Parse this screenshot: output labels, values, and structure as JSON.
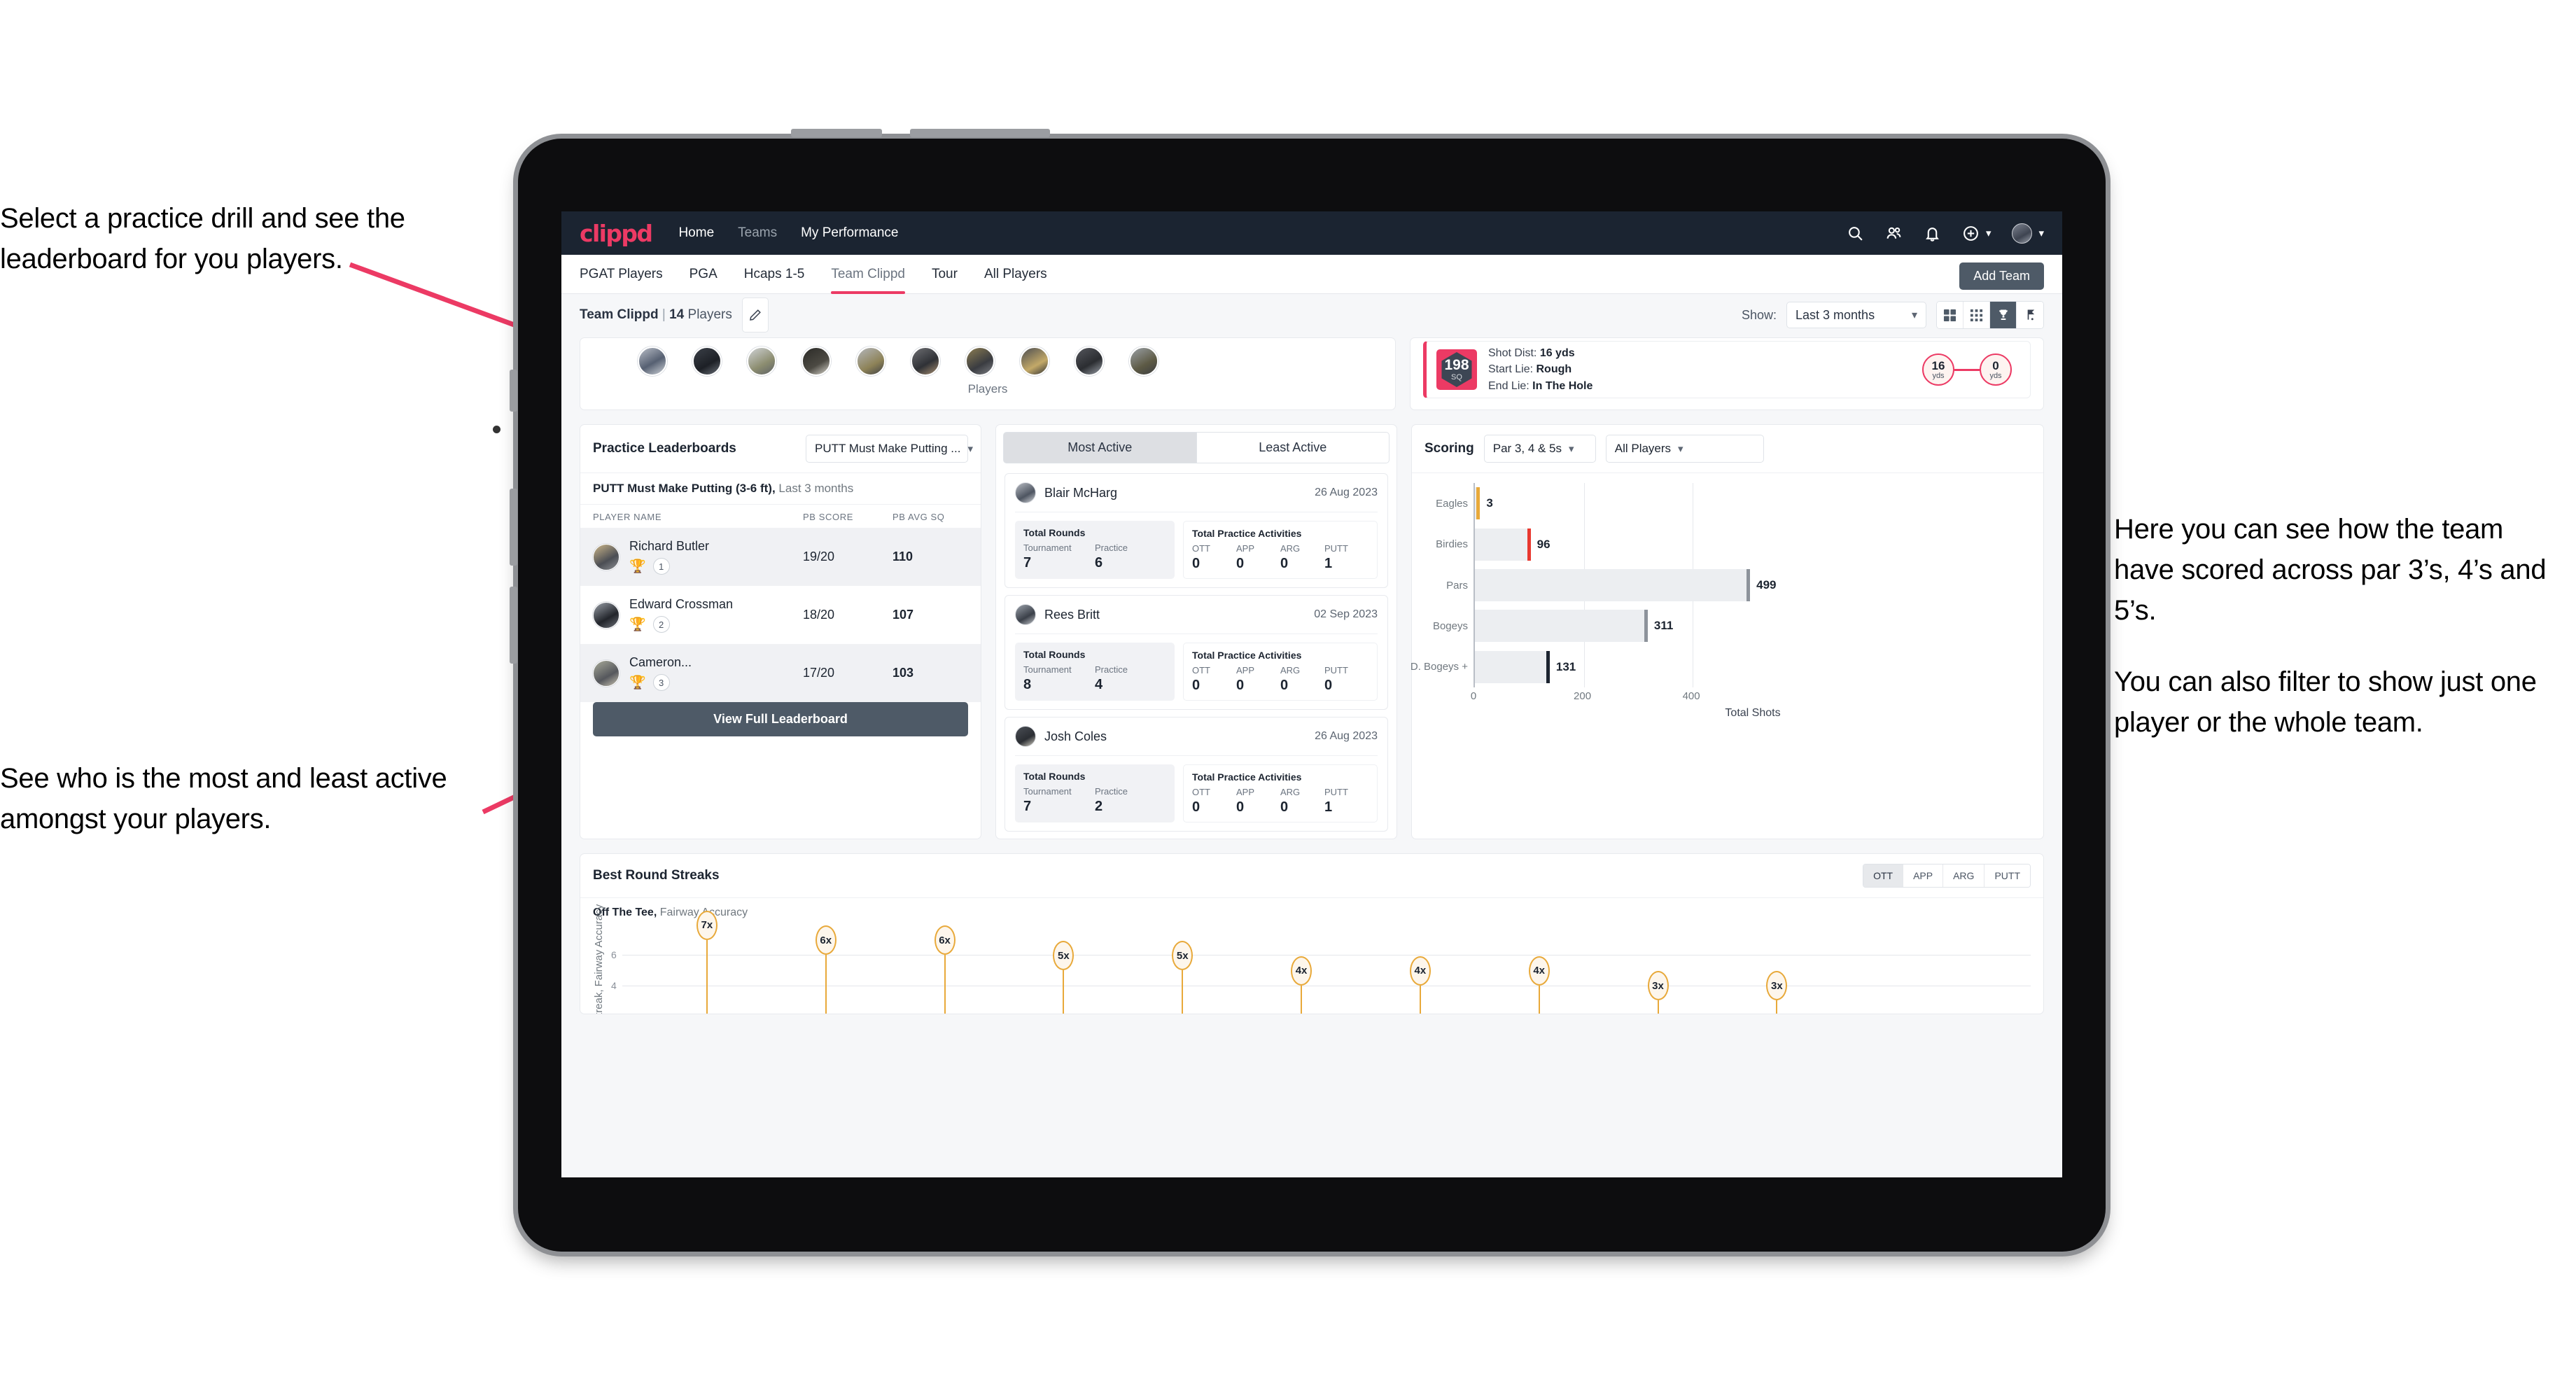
{
  "annotations": {
    "top_left": [
      "Select a practice drill and see the leaderboard for you players."
    ],
    "bottom_left": [
      "See who is the most and least active amongst your players."
    ],
    "right": [
      "Here you can see how the team have scored across par 3’s, 4’s and 5’s.",
      "You can also filter to show just one player or the whole team."
    ]
  },
  "appbar": {
    "logo": "clippd",
    "nav": [
      {
        "label": "Home",
        "active": true
      },
      {
        "label": "Teams",
        "active": false
      },
      {
        "label": "My Performance",
        "active": true
      }
    ],
    "icons": [
      "search-icon",
      "people-icon",
      "bell-icon",
      "plus-circle-icon",
      "avatar"
    ]
  },
  "tabs": [
    {
      "label": "PGAT Players",
      "active": false
    },
    {
      "label": "PGA",
      "active": false
    },
    {
      "label": "Hcaps 1-5",
      "active": false
    },
    {
      "label": "Team Clippd",
      "active": true
    },
    {
      "label": "Tour",
      "active": false
    },
    {
      "label": "All Players",
      "active": false
    }
  ],
  "add_team_button": "Add Team",
  "team_header": {
    "team": "Team Clippd",
    "separator": "|",
    "count": "14",
    "players_word": "Players",
    "edit_icon": "pencil-icon"
  },
  "show_filter": {
    "label": "Show:",
    "value": "Last 3 months"
  },
  "view_toggle": [
    {
      "icon": "grid-large-icon",
      "active": false
    },
    {
      "icon": "grid-small-icon",
      "active": false
    },
    {
      "icon": "trophy-icon",
      "active": true
    },
    {
      "icon": "golf-flag-icon",
      "active": false
    }
  ],
  "players_strip": {
    "label": "Players",
    "avatar_count": 10
  },
  "shot_card": {
    "sq_value": "198",
    "sq_unit": "SQ",
    "lines": [
      {
        "label": "Shot Dist:",
        "value": "16 yds"
      },
      {
        "label": "Start Lie:",
        "value": "Rough"
      },
      {
        "label": "End Lie:",
        "value": "In The Hole"
      }
    ],
    "start_dist": {
      "value": "16",
      "unit": "yds"
    },
    "end_dist": {
      "value": "0",
      "unit": "yds"
    }
  },
  "leaderboard": {
    "title": "Practice Leaderboards",
    "drill_select": "PUTT Must Make Putting ...",
    "subtitle_bold": "PUTT Must Make Putting (3-6 ft),",
    "subtitle_light": "Last 3 months",
    "columns": [
      "PLAYER NAME",
      "PB SCORE",
      "PB AVG SQ"
    ],
    "rows": [
      {
        "name": "Richard Butler",
        "rank": "1",
        "medal": "gold",
        "score": "19/20",
        "avg": "110"
      },
      {
        "name": "Edward Crossman",
        "rank": "2",
        "medal": "silver",
        "score": "18/20",
        "avg": "107"
      },
      {
        "name": "Cameron...",
        "rank": "3",
        "medal": "bronze",
        "score": "17/20",
        "avg": "103"
      }
    ],
    "button": "View Full Leaderboard"
  },
  "activity": {
    "tabs": [
      {
        "label": "Most Active",
        "active": true
      },
      {
        "label": "Least Active",
        "active": false
      }
    ],
    "rounds_title": "Total Rounds",
    "practice_title": "Total Practice Activities",
    "rounds_keys": [
      "Tournament",
      "Practice"
    ],
    "practice_keys": [
      "OTT",
      "APP",
      "ARG",
      "PUTT"
    ],
    "cards": [
      {
        "name": "Blair McHarg",
        "date": "26 Aug 2023",
        "rounds": [
          "7",
          "6"
        ],
        "practice": [
          "0",
          "0",
          "0",
          "1"
        ]
      },
      {
        "name": "Rees Britt",
        "date": "02 Sep 2023",
        "rounds": [
          "8",
          "4"
        ],
        "practice": [
          "0",
          "0",
          "0",
          "0"
        ]
      },
      {
        "name": "Josh Coles",
        "date": "26 Aug 2023",
        "rounds": [
          "7",
          "2"
        ],
        "practice": [
          "0",
          "0",
          "0",
          "1"
        ]
      }
    ]
  },
  "scoring": {
    "title": "Scoring",
    "par_select": "Par 3, 4 & 5s",
    "player_select": "All Players"
  },
  "streaks": {
    "title": "Best Round Streaks",
    "toggle": [
      {
        "label": "OTT",
        "active": true
      },
      {
        "label": "APP",
        "active": false
      },
      {
        "label": "ARG",
        "active": false
      },
      {
        "label": "PUTT",
        "active": false
      }
    ],
    "sub_bold": "Off The Tee,",
    "sub_light": "Fairway Accuracy"
  },
  "chart_data": [
    {
      "type": "bar",
      "title": "Scoring",
      "orientation": "horizontal",
      "categories": [
        "Eagles",
        "Birdies",
        "Pars",
        "Bogeys",
        "D. Bogeys +"
      ],
      "values": [
        3,
        96,
        499,
        311,
        131
      ],
      "cap_colors": [
        "#e8a93a",
        "#e8382f",
        "#8d939b",
        "#8d939b",
        "#1c2430"
      ],
      "xlabel": "Total Shots",
      "ylabel": "",
      "xlim": [
        0,
        540
      ],
      "xticks": [
        0,
        200,
        400
      ],
      "grid": true,
      "legend": "none"
    },
    {
      "type": "scatter",
      "title": "Best Round Streaks",
      "subtitle": "Off The Tee, Fairway Accuracy",
      "ylabel": "Streak, Fairway Accuracy",
      "xlabel": "",
      "ylim": [
        2,
        8
      ],
      "yticks": [
        4,
        6
      ],
      "grid": true,
      "labels": [
        "7x",
        "6x",
        "6x",
        "5x",
        "5x",
        "4x",
        "4x",
        "4x",
        "3x",
        "3x"
      ],
      "values": [
        7,
        6,
        6,
        5,
        5,
        4,
        4,
        4,
        3,
        3
      ],
      "x_marks": [
        "",
        "",
        "E",
        "",
        "",
        "C",
        "",
        "",
        "",
        ""
      ]
    }
  ]
}
